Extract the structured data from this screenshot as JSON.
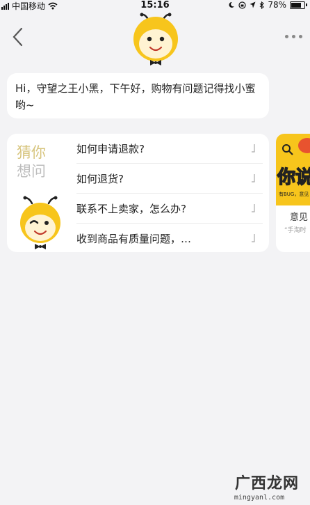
{
  "status_bar": {
    "carrier": "中国移动",
    "time": "15:16",
    "battery": "78%"
  },
  "nav": {
    "back_icon": "chevron-left-icon",
    "more_icon": "more-dots-icon",
    "avatar_icon": "bee-mascot"
  },
  "greeting": {
    "text": "Hi，守望之王小黑，下午好，购物有问题记得找小蜜哟~"
  },
  "faq": {
    "title_line1": "猜你",
    "title_line2": "想问",
    "items": [
      {
        "label": "如何申请退款?"
      },
      {
        "label": "如何退货?"
      },
      {
        "label": "联系不上卖家，怎么办?"
      },
      {
        "label": "收到商品有质量问题，…"
      }
    ]
  },
  "promo": {
    "banner_text": "你说",
    "banner_sub": "有BUG，意见",
    "title": "意见",
    "subtitle": "“手淘时"
  },
  "watermark": {
    "text": "广西龙网",
    "url": "mingyanl.com"
  },
  "colors": {
    "background": "#f3f3f5",
    "mascot_yellow": "#f7c51c",
    "guess_gold": "#d7c57e"
  }
}
